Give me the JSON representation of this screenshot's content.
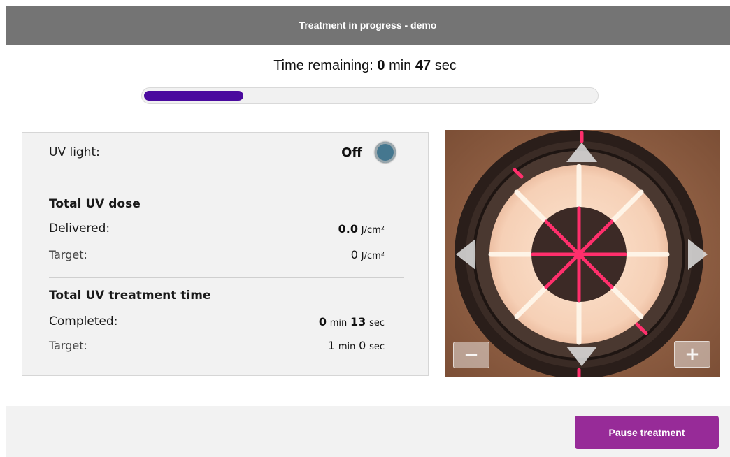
{
  "header": {
    "title": "Treatment in progress - demo"
  },
  "progress": {
    "label_prefix": "Time remaining:",
    "minutes": "0",
    "min_unit": "min",
    "seconds": "47",
    "sec_unit": "sec",
    "fraction": 0.22,
    "fill_color": "#4a0a9e"
  },
  "uv_light": {
    "label": "UV light:",
    "status": "Off",
    "indicator_icon": "status-led-icon",
    "indicator_color": "#45778f"
  },
  "dose": {
    "heading": "Total UV dose",
    "delivered_label": "Delivered:",
    "delivered_value": "0.0",
    "target_label": "Target:",
    "target_value": "0",
    "unit": "J/cm²"
  },
  "treatment_time": {
    "heading": "Total UV treatment time",
    "completed_label": "Completed:",
    "completed_min": "0",
    "completed_sec": "13",
    "target_label": "Target:",
    "target_min": "1",
    "target_sec": "0",
    "min_unit": "min",
    "sec_unit": "sec"
  },
  "camera": {
    "zoom_out_label": "−",
    "zoom_in_label": "+",
    "icons": [
      "arrow-up-icon",
      "arrow-down-icon",
      "arrow-left-icon",
      "arrow-right-icon"
    ]
  },
  "footer": {
    "pause_label": "Pause treatment",
    "pause_color": "#972b98"
  }
}
